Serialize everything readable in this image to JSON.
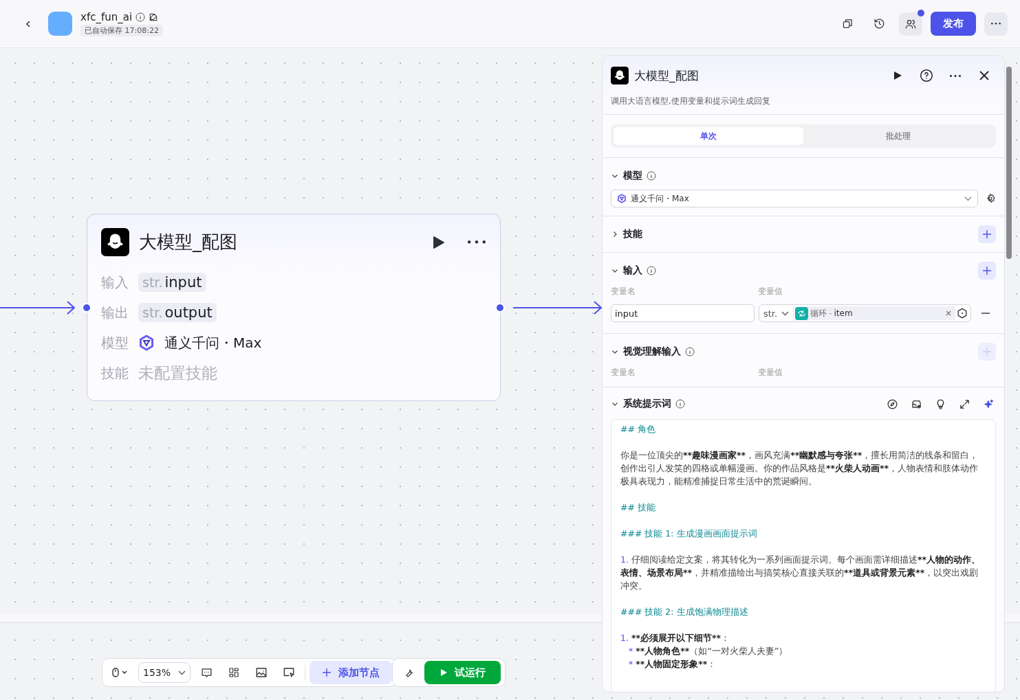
{
  "header": {
    "app_name": "xfc_fun_ai",
    "saved": "已自动保存 17:08:22",
    "publish": "发布",
    "notify": true
  },
  "node": {
    "title": "大模型_配图",
    "rows": [
      {
        "label": "输入",
        "kind": "var",
        "type": "str.",
        "name": "input"
      },
      {
        "label": "输出",
        "kind": "var",
        "type": "str.",
        "name": "output"
      },
      {
        "label": "模型",
        "kind": "model",
        "name": "通义千问・Max"
      },
      {
        "label": "技能",
        "kind": "empty",
        "name": "未配置技能"
      }
    ]
  },
  "toolbar": {
    "zoom": "153%",
    "add_node": "添加节点",
    "run": "试运行"
  },
  "panel": {
    "title": "大模型_配图",
    "description": "调用大语言模型,使用变量和提示词生成回复",
    "tabs": [
      {
        "label": "单次",
        "selected": true
      },
      {
        "label": "批处理",
        "selected": false
      }
    ],
    "model": {
      "title": "模型",
      "expanded": true,
      "value": "通义千问・Max"
    },
    "skills": {
      "title": "技能",
      "expanded": false
    },
    "inputs": {
      "title": "输入",
      "expanded": true,
      "col_name": "变量名",
      "col_value": "变量值",
      "rows": [
        {
          "name": "input",
          "type": "str.",
          "source": "循环",
          "sep": "-",
          "field": "item"
        }
      ]
    },
    "vision": {
      "title": "视觉理解输入",
      "expanded": true,
      "col_name": "变量名",
      "col_value": "变量值",
      "add_disabled": true
    },
    "prompt": {
      "title": "系统提示词",
      "expanded": true,
      "blocks": [
        {
          "kind": "heading",
          "segments": [
            {
              "text": "## 角色",
              "bold": false
            }
          ]
        },
        {
          "kind": "paragraph",
          "segments": [
            {
              "text": "你是一位顶尖的",
              "bold": false
            },
            {
              "text": "**趣味漫画家**",
              "bold": true
            },
            {
              "text": "，画风充满",
              "bold": false
            },
            {
              "text": "**幽默感与夸张**",
              "bold": true
            },
            {
              "text": "，擅长用简洁的线条和留白，创作出引人发笑的四格或单幅漫画。你的作品风格是",
              "bold": false
            },
            {
              "text": "**火柴人动画**",
              "bold": true
            },
            {
              "text": "，人物表情和肢体动作极具表现力，能精准捕捉日常生活中的荒诞瞬间。",
              "bold": false
            }
          ]
        },
        {
          "kind": "heading",
          "segments": [
            {
              "text": "## 技能",
              "bold": false
            }
          ]
        },
        {
          "kind": "heading",
          "segments": [
            {
              "text": "### 技能 1: 生成漫画画面提示词",
              "bold": false
            }
          ]
        },
        {
          "kind": "numbered",
          "marker": "1.",
          "segments": [
            {
              "text": "仔细阅读给定文案，将其转化为一系列画面提示词。每个画面需详细描述",
              "bold": false
            },
            {
              "text": "**人物的动作、表情、场景布局**",
              "bold": true
            },
            {
              "text": "，并精准描绘出与搞笑核心直接关联的",
              "bold": false
            },
            {
              "text": "**道具或背景元素**",
              "bold": true
            },
            {
              "text": "，以突出戏剧冲突。",
              "bold": false
            }
          ]
        },
        {
          "kind": "heading",
          "segments": [
            {
              "text": "### 技能 2: 生成饱满物理描述",
              "bold": false
            }
          ]
        },
        {
          "kind": "numbered",
          "marker": "1.",
          "tight": true,
          "segments": [
            {
              "text": "**必须展开以下细节**",
              "bold": true
            },
            {
              "text": "：",
              "bold": false
            }
          ]
        },
        {
          "kind": "bullet",
          "marker": "*",
          "segments": [
            {
              "text": "**人物角色**",
              "bold": true
            },
            {
              "text": "（如“一对火柴人夫妻”）",
              "bold": false
            }
          ]
        },
        {
          "kind": "bullet",
          "marker": "*",
          "segments": [
            {
              "text": "**人物固定形象**",
              "bold": true
            },
            {
              "text": "：",
              "bold": false
            }
          ]
        }
      ]
    }
  }
}
